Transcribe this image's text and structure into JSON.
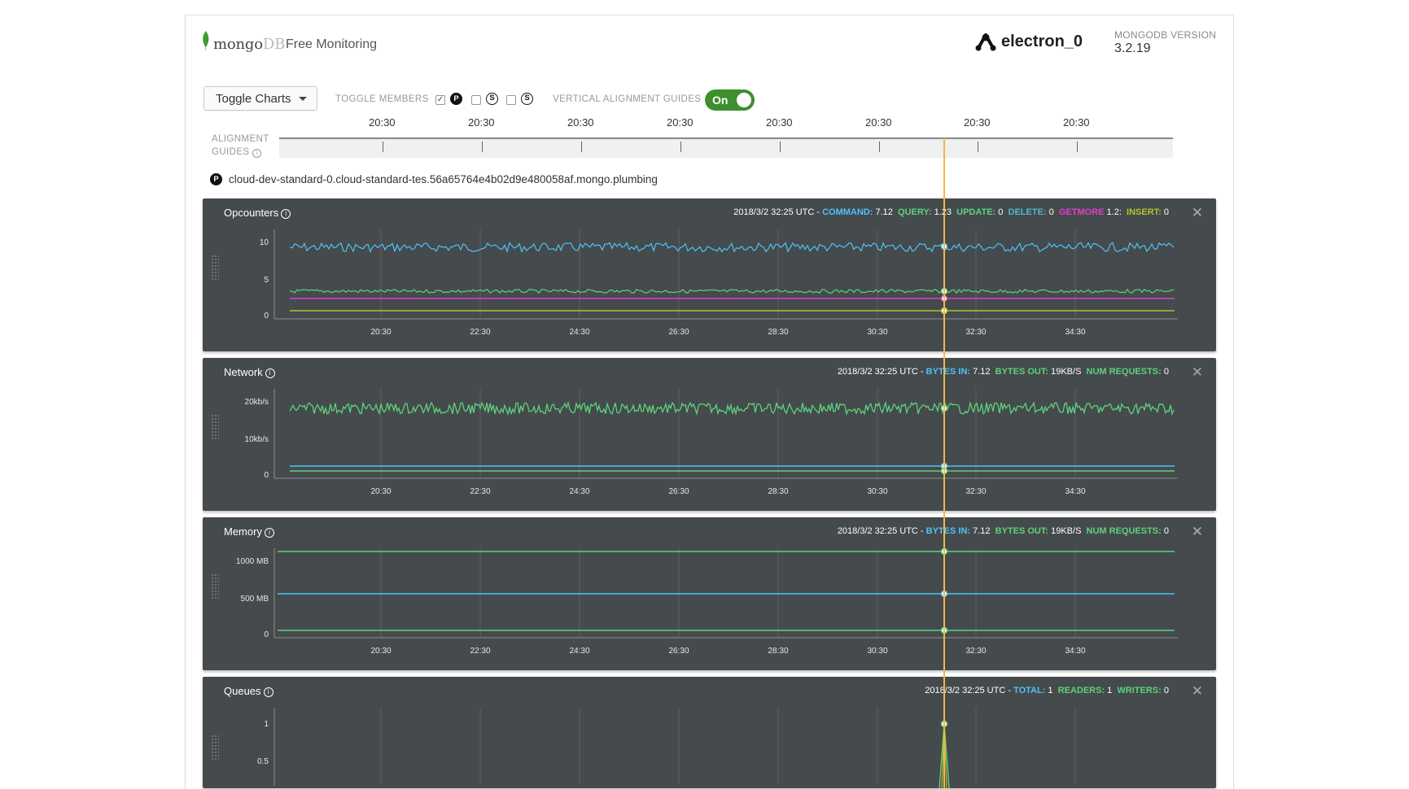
{
  "header": {
    "brand_main": "mongo",
    "brand_suffix": "DB",
    "product": "Free Monitoring",
    "hostname": "electron_0",
    "version_label": "MONGODB VERSION",
    "version_value": "3.2.19"
  },
  "controls": {
    "toggle_charts_label": "Toggle Charts",
    "toggle_members_label": "TOGGLE MEMBERS",
    "members": [
      {
        "badge": "P",
        "checked": true
      },
      {
        "badge": "S",
        "checked": false
      },
      {
        "badge": "S",
        "checked": false
      }
    ],
    "vertical_guides_label": "VERTICAL ALIGNMENT GUIDES",
    "vertical_guides_state": "On"
  },
  "alignment": {
    "label_line1": "ALIGNMENT",
    "label_line2": "GUIDES",
    "ticks": [
      "20:30",
      "20:30",
      "20:30",
      "20:30",
      "20:30",
      "20:30",
      "20:30",
      "20:30"
    ]
  },
  "member": {
    "badge": "P",
    "hostname": "cloud-dev-standard-0.cloud-standard-tes.56a65764e4b02d9e480058af.mongo.plumbing"
  },
  "colors": {
    "card_bg": "#454a4d",
    "blue": "#4fc3f7",
    "green": "#5cd37a",
    "magenta": "#e040c8",
    "olive": "#b5c032",
    "guide": "#f5b740",
    "switch": "#3e8f2f"
  },
  "cards": [
    {
      "title": "Opcounters",
      "status": [
        {
          "text": "2018/3/2 32:25 UTC - ",
          "color": "#ffffff"
        },
        {
          "text": "COMMAND:",
          "color": "#4fc3f7",
          "bold": true
        },
        {
          "text": " 7.12  ",
          "color": "#ffffff"
        },
        {
          "text": "QUERY:",
          "color": "#5cd37a",
          "bold": true
        },
        {
          "text": " 1.23  ",
          "color": "#ffffff"
        },
        {
          "text": "UPDATE:",
          "color": "#5cd37a",
          "bold": true
        },
        {
          "text": " 0  ",
          "color": "#ffffff"
        },
        {
          "text": "DELETE:",
          "color": "#4fb8c8",
          "bold": true
        },
        {
          "text": " 0  ",
          "color": "#ffffff"
        },
        {
          "text": "GETMORE",
          "color": "#e040c8",
          "bold": true
        },
        {
          "text": " 1.2:  ",
          "color": "#ffffff"
        },
        {
          "text": "INSERT:",
          "color": "#b5c032",
          "bold": true
        },
        {
          "text": " 0",
          "color": "#ffffff"
        }
      ],
      "y_ticks": [
        "10",
        "5",
        "0"
      ],
      "x_ticks": [
        "20:30",
        "22:30",
        "24:30",
        "26:30",
        "28:30",
        "30:30",
        "32:30",
        "34:30"
      ]
    },
    {
      "title": "Network",
      "status": [
        {
          "text": "2018/3/2 32:25 UTC - ",
          "color": "#ffffff"
        },
        {
          "text": "BYTES IN:",
          "color": "#4fc3f7",
          "bold": true
        },
        {
          "text": " 7.12  ",
          "color": "#ffffff"
        },
        {
          "text": "BYTES OUT:",
          "color": "#5cd37a",
          "bold": true
        },
        {
          "text": " 19KB/S  ",
          "color": "#ffffff"
        },
        {
          "text": "NUM REQUESTS:",
          "color": "#5cd37a",
          "bold": true
        },
        {
          "text": " 0",
          "color": "#ffffff"
        }
      ],
      "y_ticks": [
        "20kb/s",
        "10kb/s",
        "0"
      ],
      "x_ticks": [
        "20:30",
        "22:30",
        "24:30",
        "26:30",
        "28:30",
        "30:30",
        "32:30",
        "34:30"
      ]
    },
    {
      "title": "Memory",
      "status": [
        {
          "text": "2018/3/2 32:25 UTC - ",
          "color": "#ffffff"
        },
        {
          "text": "BYTES IN:",
          "color": "#4fc3f7",
          "bold": true
        },
        {
          "text": " 7.12  ",
          "color": "#ffffff"
        },
        {
          "text": "BYTES OUT:",
          "color": "#5cd37a",
          "bold": true
        },
        {
          "text": " 19KB/S  ",
          "color": "#ffffff"
        },
        {
          "text": "NUM REQUESTS:",
          "color": "#5cd37a",
          "bold": true
        },
        {
          "text": " 0",
          "color": "#ffffff"
        }
      ],
      "y_ticks": [
        "1000 MB",
        "500 MB",
        "0"
      ],
      "x_ticks": [
        "20:30",
        "22:30",
        "24:30",
        "26:30",
        "28:30",
        "30:30",
        "32:30",
        "34:30"
      ]
    },
    {
      "title": "Queues",
      "status": [
        {
          "text": "2018/3/2 32:25 UTC - ",
          "color": "#ffffff"
        },
        {
          "text": "TOTAL:",
          "color": "#4fc3f7",
          "bold": true
        },
        {
          "text": " 1  ",
          "color": "#ffffff"
        },
        {
          "text": "READERS:",
          "color": "#5cd37a",
          "bold": true
        },
        {
          "text": " 1  ",
          "color": "#ffffff"
        },
        {
          "text": "WRITERS:",
          "color": "#5cd37a",
          "bold": true
        },
        {
          "text": " 0",
          "color": "#ffffff"
        }
      ],
      "y_ticks": [
        "1",
        "0.5"
      ],
      "x_ticks": []
    }
  ]
}
